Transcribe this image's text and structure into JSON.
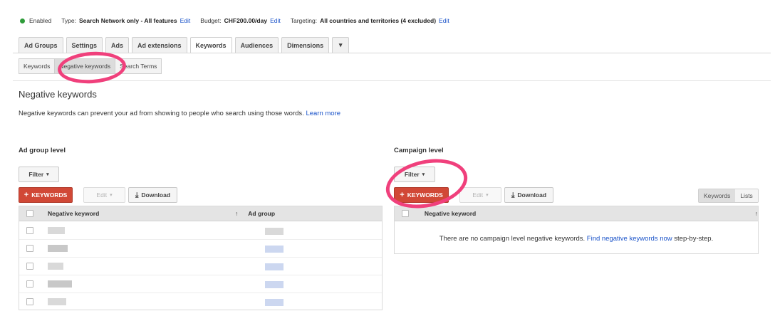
{
  "status": {
    "enabled": "Enabled",
    "type_label": "Type:",
    "type_value": "Search Network only - All features",
    "type_edit": "Edit",
    "budget_label": "Budget:",
    "budget_value": "CHF200.00/day",
    "budget_edit": "Edit",
    "targeting_label": "Targeting:",
    "targeting_value": "All countries and territories (4 excluded)",
    "targeting_edit": "Edit",
    "enabled_color": "#2e9c3a"
  },
  "tabs": [
    {
      "label": "Ad Groups"
    },
    {
      "label": "Settings"
    },
    {
      "label": "Ads"
    },
    {
      "label": "Ad extensions"
    },
    {
      "label": "Keywords"
    },
    {
      "label": "Audiences"
    },
    {
      "label": "Dimensions"
    }
  ],
  "tab_more_glyph": "▾",
  "subtabs": [
    {
      "label": "Keywords"
    },
    {
      "label": "Negative keywords"
    },
    {
      "label": "Search Terms"
    }
  ],
  "page": {
    "title": "Negative keywords",
    "description": "Negative keywords can prevent your ad from showing to people who search using those words.",
    "learn_more": "Learn more"
  },
  "ad_group_level": {
    "title": "Ad group level",
    "filter_label": "Filter",
    "add_keywords_label": "KEYWORDS",
    "edit_label": "Edit",
    "download_label": "Download",
    "columns": {
      "keyword": "Negative keyword",
      "sort": "↑",
      "ad_group": "Ad group"
    }
  },
  "campaign_level": {
    "title": "Campaign level",
    "filter_label": "Filter",
    "add_keywords_label": "KEYWORDS",
    "edit_label": "Edit",
    "download_label": "Download",
    "view_keywords": "Keywords",
    "view_lists": "Lists",
    "columns": {
      "keyword": "Negative keyword",
      "sort": "↑"
    },
    "empty_text": "There are no campaign level negative keywords.",
    "empty_link": "Find negative keywords now",
    "empty_suffix": "step-by-step."
  },
  "glyphs": {
    "plus": "+",
    "caret": "▾",
    "download": "⤓"
  },
  "colors": {
    "accent_red": "#d14836",
    "link": "#1a53c9",
    "highlight": "#f0407c"
  }
}
